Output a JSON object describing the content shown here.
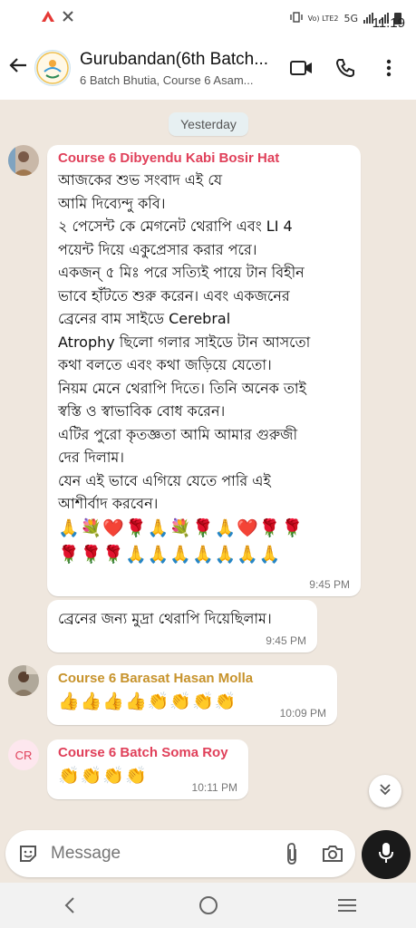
{
  "status": {
    "time": "11:19",
    "network_label": "Vo) LTE2",
    "network_type": "5G"
  },
  "header": {
    "title": "Gurubandan(6th Batch...",
    "subtitle": "6 Batch Bhutia, Course 6 Asam..."
  },
  "chat": {
    "date_divider": "Yesterday",
    "messages": [
      {
        "sender": "Course 6 Dibyendu Kabi Bosir Hat",
        "sender_color": "#e0405a",
        "lines": [
          "আজকের শুভ সংবাদ এই যে",
          "আমি দিব্যেন্দু কবি।",
          "২ পেসেন্ট কে মেগনেট থেরাপি এবং LI 4",
          "পয়েন্ট দিয়ে একুপ্রেসার করার পরে।",
          "একজন্ ৫ মিঃ পরে সত্যিই পায়ে টান বিহীন",
          "ভাবে হাঁটতে শুরু করেন। এবং একজনের",
          "ব্রেনের বাম সাইডে Cerebral",
          "Atrophy ছিলো গলার সাইডে টান আসতো",
          "কথা বলতে এবং কথা জড়িয়ে যেতো।",
          "নিয়ম মেনে থেরাপি দিতে। তিনি অনেক তাই",
          "স্বস্তি ও স্বাভাবিক বোধ করেন।",
          "এটির পুরো কৃতজ্ঞতা আমি আমার গুরুজী",
          "দের দিলাম।",
          "যেন এই ভাবে এগিয়ে যেতে পারি এই",
          "আশীর্বাদ করবেন।"
        ],
        "emoji_lines": [
          "🙏💐❤️🌹🙏💐🌹🙏❤️🌹🌹",
          "🌹🌹🌹🙏🙏🙏🙏🙏🙏🙏"
        ],
        "time": "9:45 PM"
      },
      {
        "text": "ব্রেনের জন্য মুদ্রা থেরাপি দিয়েছিলাম।",
        "time": "9:45 PM"
      },
      {
        "sender": "Course 6 Barasat Hasan Molla",
        "sender_color": "#c7932c",
        "emoji": "👍👍👍👍👏👏👏👏",
        "time": "10:09 PM"
      },
      {
        "sender": "Course 6 Batch Soma Roy",
        "sender_color": "#e0405a",
        "avatar_initials": "CR",
        "emoji": "👏👏👏👏",
        "time": "10:11 PM"
      }
    ]
  },
  "input": {
    "placeholder": "Message"
  }
}
